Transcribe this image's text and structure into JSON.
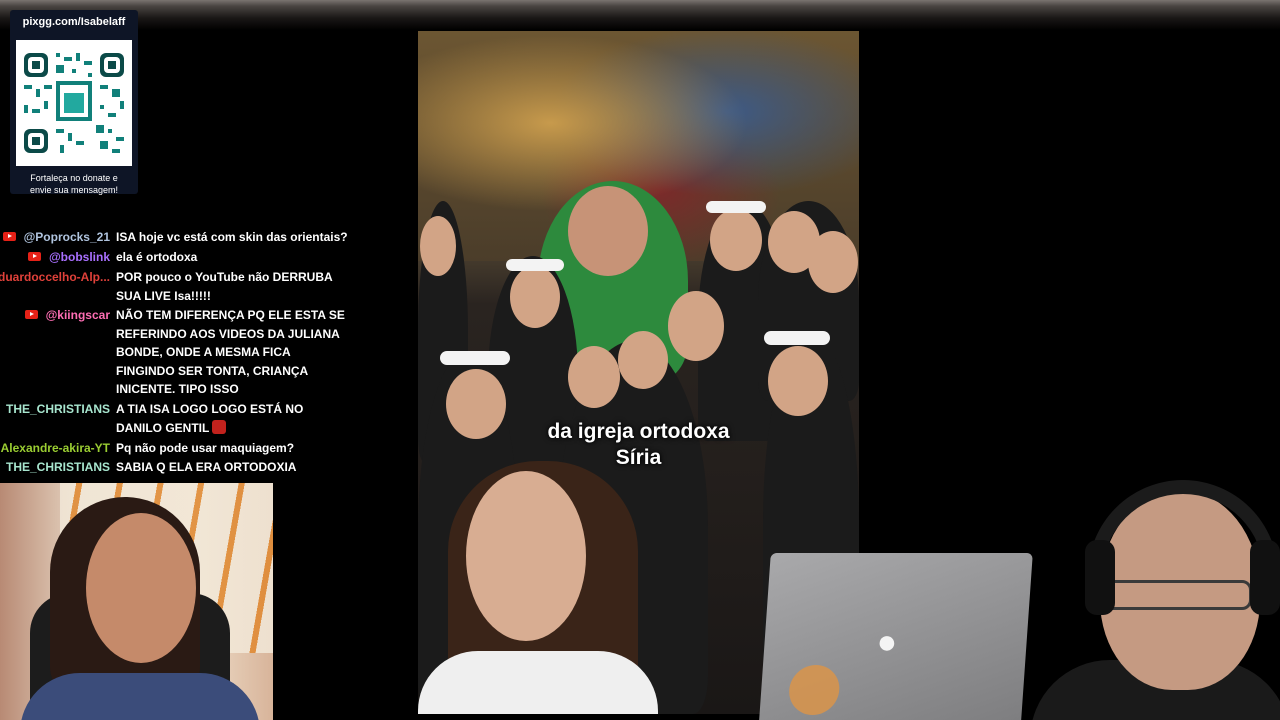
{
  "donate": {
    "url": "pixgg.com/Isabelaff",
    "caption_line1": "Fortaleça no donate e",
    "caption_line2": "envie sua mensagem!"
  },
  "chat": {
    "messages": [
      {
        "user": "@Poprocks_21",
        "text": "ISA hoje vc está com skin das orientais?",
        "color": "#b0c4de",
        "youtube": true
      },
      {
        "user": "@bobslink",
        "text": "ela é ortodoxa",
        "color": "#a970ff",
        "youtube": true
      },
      {
        "user": "duardoccelho-Alp...",
        "text": "POR pouco o YouTube não DERRUBA SUA LIVE Isa!!!!!",
        "color": "#e0413a",
        "youtube": false
      },
      {
        "user": "@kiingscar",
        "text": "NÃO TEM DIFERENÇA PQ ELE ESTA SE REFERINDO AOS VIDEOS DA JULIANA BONDE, ONDE A MESMA FICA FINGINDO SER TONTA, CRIANÇA INICENTE. TIPO ISSO",
        "color": "#ff6eb4",
        "youtube": true
      },
      {
        "user": "THE_CHRISTIANS",
        "text": "A TIA ISA LOGO LOGO ESTÁ NO DANILO GENTIL",
        "color": "#a8e6cf",
        "youtube": false
      },
      {
        "user": "Alexandre-akira-YT",
        "text": "Pq não pode usar maquiagem?",
        "color": "#9acd32",
        "youtube": false
      },
      {
        "user": "THE_CHRISTIANS",
        "text": "SABIA Q ELA ERA ORTODOXIA",
        "color": "#a8e6cf",
        "youtube": false
      }
    ]
  },
  "video": {
    "caption_line1": "da igreja ortodoxa",
    "caption_line2": "Síria"
  },
  "icons": {
    "laptop_logo": "apple-icon",
    "chat_badge": "youtube-icon"
  }
}
